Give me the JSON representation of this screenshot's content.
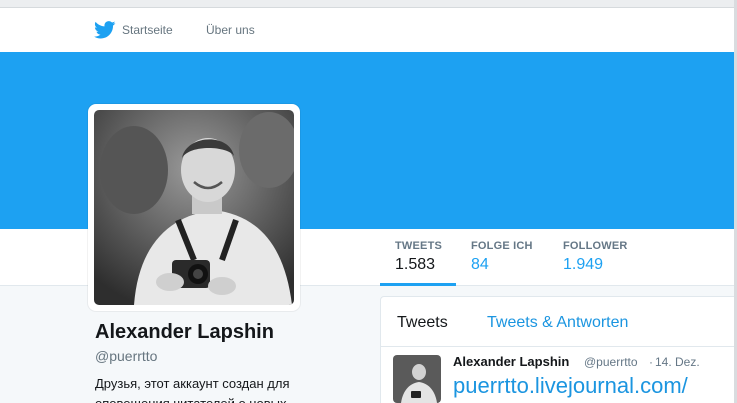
{
  "topnav": {
    "home_label": "Startseite",
    "about_label": "Über uns",
    "home_icon": "twitter-bird-icon"
  },
  "profile": {
    "name": "Alexander Lapshin",
    "handle": "@puerrtto",
    "bio": "Друзья, этот аккаунт создан для оповещения читателей о новых"
  },
  "stats": [
    {
      "label": "TWEETS",
      "value": "1.583"
    },
    {
      "label": "FOLGE ICH",
      "value": "84"
    },
    {
      "label": "FOLLOWER",
      "value": "1.949"
    }
  ],
  "timeline": {
    "tabs": [
      "Tweets",
      "Tweets & Antworten"
    ],
    "tweet": {
      "name": "Alexander Lapshin",
      "handle": "@puerrtto",
      "separator": "·",
      "date": "14. Dez.",
      "link_text": "puerrtto.livejournal.com/"
    }
  },
  "colors": {
    "brand_blue": "#1da1f2",
    "link_blue": "#1b95e0",
    "text": "#14171a",
    "muted": "#657786"
  }
}
